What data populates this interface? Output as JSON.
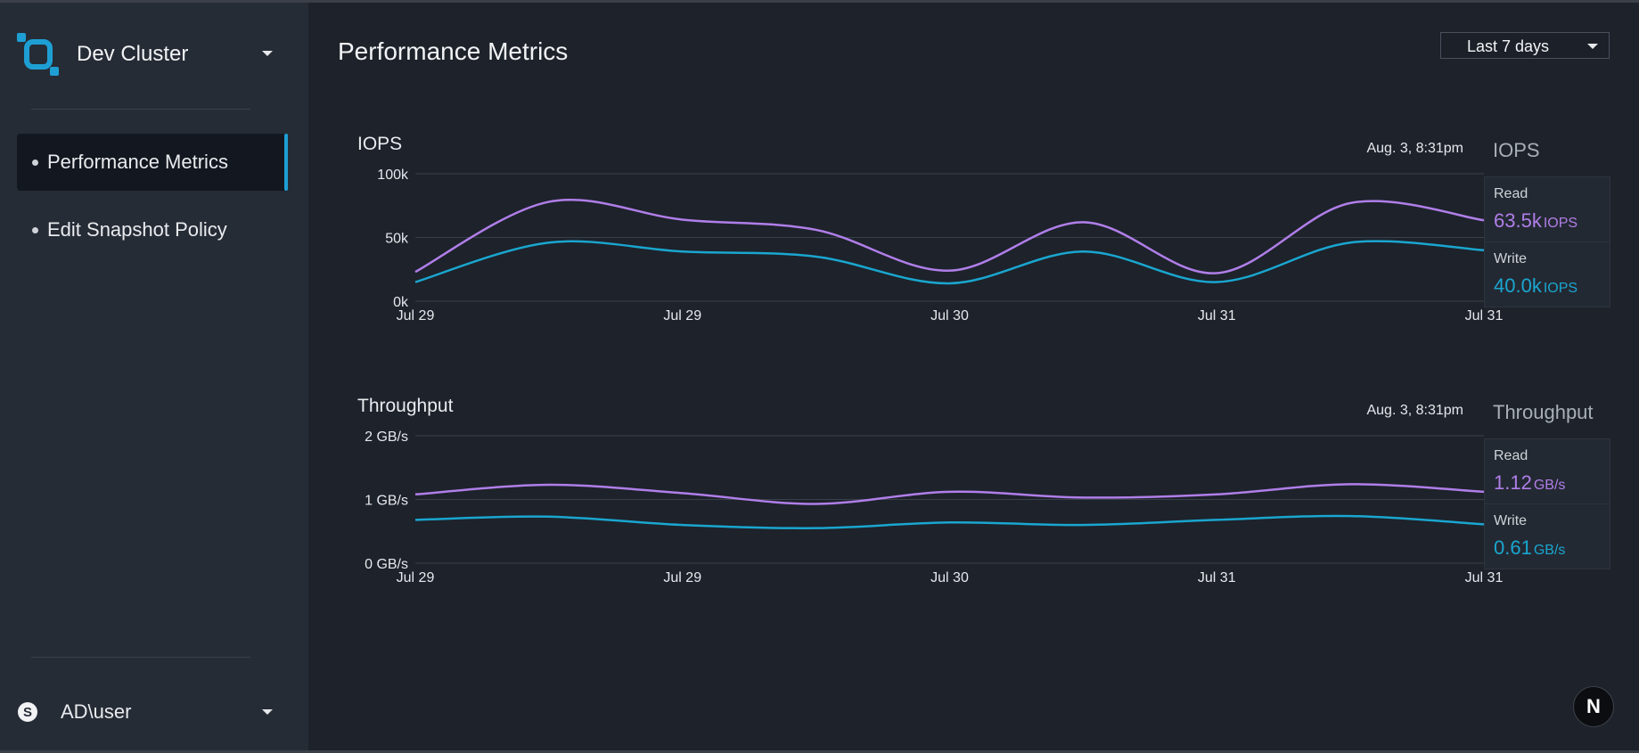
{
  "colors": {
    "accent": "#1e9fd4",
    "read": "#b07ee8",
    "write": "#1aa6cf",
    "background": "#1d222b",
    "sidebar": "#262c36"
  },
  "sidebar": {
    "cluster_name": "Dev Cluster",
    "logo_icon": "cluster-logo-icon",
    "items": [
      {
        "label": "Performance Metrics",
        "active": true
      },
      {
        "label": "Edit Snapshot Policy",
        "active": false
      }
    ],
    "user": {
      "avatar_letter": "S",
      "name": "AD\\user"
    }
  },
  "main": {
    "title": "Performance Metrics",
    "range": {
      "selected": "Last 7 days"
    }
  },
  "panels": {
    "iops": {
      "title": "IOPS",
      "read_label": "Read",
      "read_value": "63.5k",
      "read_unit": "IOPS",
      "write_label": "Write",
      "write_value": "40.0k",
      "write_unit": "IOPS"
    },
    "throughput": {
      "title": "Throughput",
      "read_label": "Read",
      "read_value": "1.12",
      "read_unit": "GB/s",
      "write_label": "Write",
      "write_value": "0.61",
      "write_unit": "GB/s"
    }
  },
  "badge": {
    "letter": "N"
  },
  "chart_data": [
    {
      "type": "line",
      "title": "IOPS",
      "timestamp": "Aug. 3, 8:31pm",
      "x_ticks": [
        "Jul 29",
        "Jul 29",
        "Jul 30",
        "Jul 31",
        "Jul 31"
      ],
      "y_ticks": [
        "0k",
        "50k",
        "100k"
      ],
      "ylim": [
        0,
        100000
      ],
      "x": [
        0,
        0.125,
        0.25,
        0.375,
        0.5,
        0.625,
        0.75,
        0.875,
        1
      ],
      "series": [
        {
          "name": "Read",
          "values": [
            23000,
            78000,
            64000,
            56000,
            24000,
            62000,
            22000,
            77000,
            63500
          ]
        },
        {
          "name": "Write",
          "values": [
            15000,
            46000,
            39000,
            35000,
            14000,
            39000,
            15000,
            46000,
            40000
          ]
        }
      ],
      "grid": true
    },
    {
      "type": "line",
      "title": "Throughput",
      "timestamp": "Aug. 3, 8:31pm",
      "x_ticks": [
        "Jul 29",
        "Jul 29",
        "Jul 30",
        "Jul 31",
        "Jul 31"
      ],
      "y_ticks": [
        "0 GB/s",
        "1 GB/s",
        "2 GB/s"
      ],
      "ylim": [
        0,
        2
      ],
      "x": [
        0,
        0.125,
        0.25,
        0.375,
        0.5,
        0.625,
        0.75,
        0.875,
        1
      ],
      "series": [
        {
          "name": "Read",
          "values": [
            1.08,
            1.23,
            1.1,
            0.93,
            1.12,
            1.03,
            1.08,
            1.24,
            1.12
          ]
        },
        {
          "name": "Write",
          "values": [
            0.68,
            0.73,
            0.6,
            0.55,
            0.64,
            0.6,
            0.68,
            0.74,
            0.61
          ]
        }
      ],
      "grid": true
    }
  ]
}
